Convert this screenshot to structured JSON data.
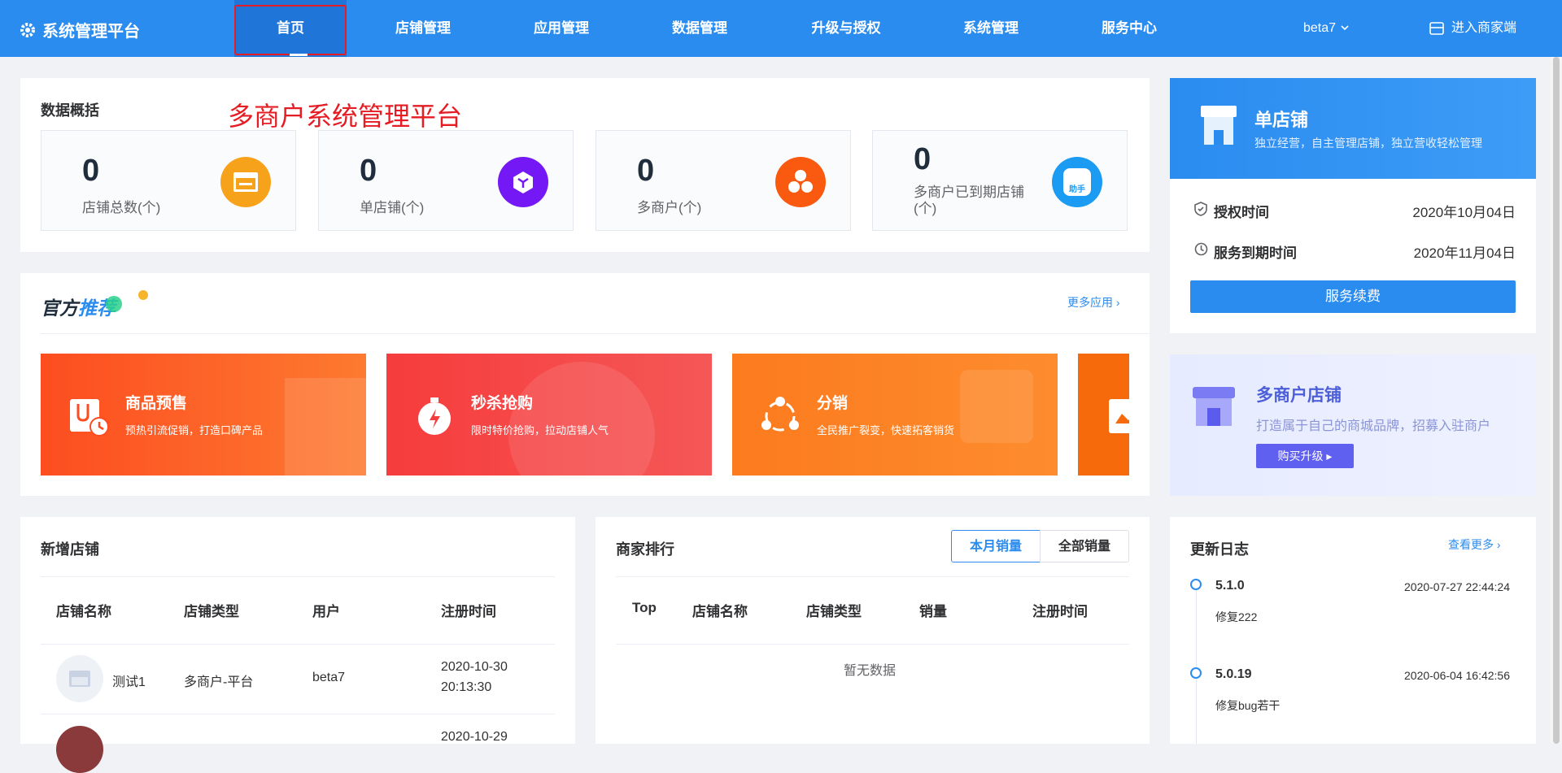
{
  "header": {
    "brand": "系统管理平台",
    "nav": [
      "首页",
      "店铺管理",
      "应用管理",
      "数据管理",
      "升级与授权",
      "系统管理",
      "服务中心"
    ],
    "user": "beta7",
    "merchant_link": "进入商家端",
    "colors": {
      "primary": "#2b8cf0",
      "active": "#1f75d8"
    }
  },
  "overview": {
    "title": "数据概括",
    "annotation": "多商户系统管理平台",
    "stats": [
      {
        "value": "0",
        "label": "店铺总数(个)",
        "icon": "store-icon",
        "color": "#f7a21b"
      },
      {
        "value": "0",
        "label": "单店铺(个)",
        "icon": "cube-icon",
        "color": "#7418f5"
      },
      {
        "value": "0",
        "label": "多商户(个)",
        "icon": "hexagons-icon",
        "color": "#fa5a0f"
      },
      {
        "value": "0",
        "label": "多商户已到期店铺(个)",
        "icon": "helper-bag-icon",
        "icon_text": "助手",
        "color": "#1c9bf2"
      }
    ]
  },
  "recommend": {
    "title_a": "官方",
    "title_b": "推荐",
    "more": "更多应用",
    "items": [
      {
        "title": "商品预售",
        "desc": "预热引流促销，打造口碑产品",
        "icon": "presale-icon",
        "color": "#fc5220"
      },
      {
        "title": "秒杀抢购",
        "desc": "限时特价抢购，拉动店铺人气",
        "icon": "stopwatch-icon",
        "color": "#f64040"
      },
      {
        "title": "分销",
        "desc": "全民推广裂变，快速拓客销货",
        "icon": "share-icon",
        "color": "#fc7d1e"
      },
      {
        "title": "",
        "desc": "",
        "icon": "poster-icon",
        "color": "#f66a0c"
      }
    ]
  },
  "new_stores": {
    "title": "新增店铺",
    "columns": [
      "店铺名称",
      "店铺类型",
      "用户",
      "注册时间"
    ],
    "rows": [
      {
        "name": "测试1",
        "type": "多商户-平台",
        "user": "beta7",
        "date": "2020-10-30",
        "time": "20:13:30"
      },
      {
        "name": "",
        "type": "",
        "user": "",
        "date": "2020-10-29",
        "time": ""
      }
    ]
  },
  "ranking": {
    "title": "商家排行",
    "tabs": [
      "本月销量",
      "全部销量"
    ],
    "columns": [
      "Top",
      "店铺名称",
      "店铺类型",
      "销量",
      "注册时间"
    ],
    "empty": "暂无数据"
  },
  "single_store": {
    "title": "单店铺",
    "desc": "独立经营，自主管理店铺，独立营收轻松管理",
    "auth_label": "授权时间",
    "auth_date": "2020年10月04日",
    "expire_label": "服务到期时间",
    "expire_date": "2020年11月04日",
    "renew": "服务续费"
  },
  "multi_store": {
    "title": "多商户店铺",
    "desc": "打造属于自己的商城品牌，招募入驻商户",
    "button": "购买升级"
  },
  "changelog": {
    "title": "更新日志",
    "more": "查看更多",
    "entries": [
      {
        "version": "5.1.0",
        "time": "2020-07-27 22:44:24",
        "note": "修复222"
      },
      {
        "version": "5.0.19",
        "time": "2020-06-04 16:42:56",
        "note": "修复bug若干"
      }
    ]
  }
}
